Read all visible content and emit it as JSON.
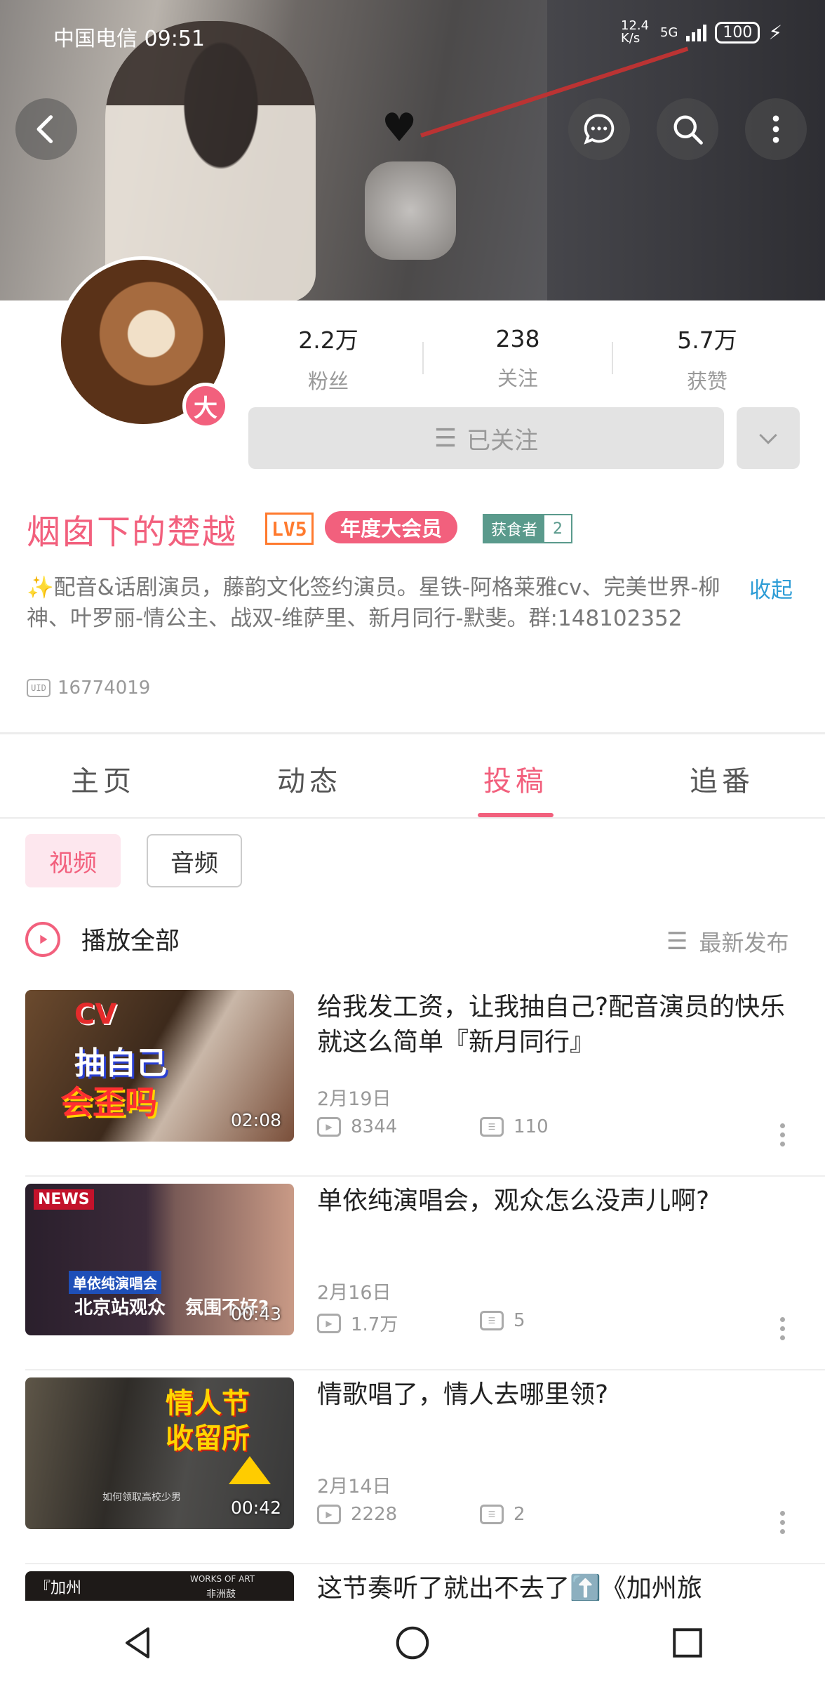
{
  "status_bar": {
    "carrier": "中国电信",
    "time": "09:51",
    "net_speed": "12.4 K/s",
    "network": "5G",
    "battery": "100"
  },
  "header": {
    "back_icon": "chevron-left-icon",
    "message_icon": "chat-bubble-icon",
    "search_icon": "search-icon",
    "more_icon": "more-vertical-icon"
  },
  "profile": {
    "avatar_badge": "大",
    "stats": [
      {
        "value": "2.2万",
        "label": "粉丝"
      },
      {
        "value": "238",
        "label": "关注"
      },
      {
        "value": "5.7万",
        "label": "获赞"
      }
    ],
    "follow_button": "已关注",
    "name": "烟囱下的楚越",
    "level": "LV5",
    "vip": "年度大会员",
    "medal_name": "获食者",
    "medal_level": "2",
    "bio": "✨配音&话剧演员，藤韵文化签约演员。星铁-阿格莱雅cv、完美世界-柳神、叶罗丽-情公主、战双-维萨里、新月同行-默斐。群:148102352",
    "collapse": "收起",
    "uid_label": "UID",
    "uid": "16774019"
  },
  "tabs": [
    {
      "label": "主页"
    },
    {
      "label": "动态"
    },
    {
      "label": "投稿",
      "active": true
    },
    {
      "label": "追番"
    }
  ],
  "filters": {
    "video": "视频",
    "audio": "音频"
  },
  "list_header": {
    "play_all": "播放全部",
    "sort": "最新发布"
  },
  "videos": [
    {
      "title": "给我发工资，让我抽自己?配音演员的快乐就这么简单『新月同行』",
      "date": "2月19日",
      "views": "8344",
      "comments": "110",
      "duration": "02:08",
      "thumb_texts": [
        "CV",
        "抽自己",
        "会歪吗"
      ]
    },
    {
      "title": "单依纯演唱会，观众怎么没声儿啊?",
      "date": "2月16日",
      "views": "1.7万",
      "comments": "5",
      "duration": "00:43",
      "thumb_texts": [
        "NEWS",
        "单依纯演唱会",
        "北京站观众",
        "氛围不好?"
      ]
    },
    {
      "title": "情歌唱了，情人去哪里领?",
      "date": "2月14日",
      "views": "2228",
      "comments": "2",
      "duration": "00:42",
      "thumb_texts": [
        "情人节",
        "收留所",
        "如何领取高校少男"
      ]
    },
    {
      "title": "这节奏听了就出不去了⬆️《加州旅",
      "thumb_texts": [
        "『加州",
        "WORKS OF ART",
        "非洲鼓"
      ]
    }
  ],
  "nav": {
    "back": "triangle-back-icon",
    "home": "circle-home-icon",
    "recent": "square-recent-icon"
  },
  "colors": {
    "accent": "#f2607d",
    "link": "#2e9dd6",
    "level": "#ff7a2e",
    "medal": "#5a9a8c"
  }
}
